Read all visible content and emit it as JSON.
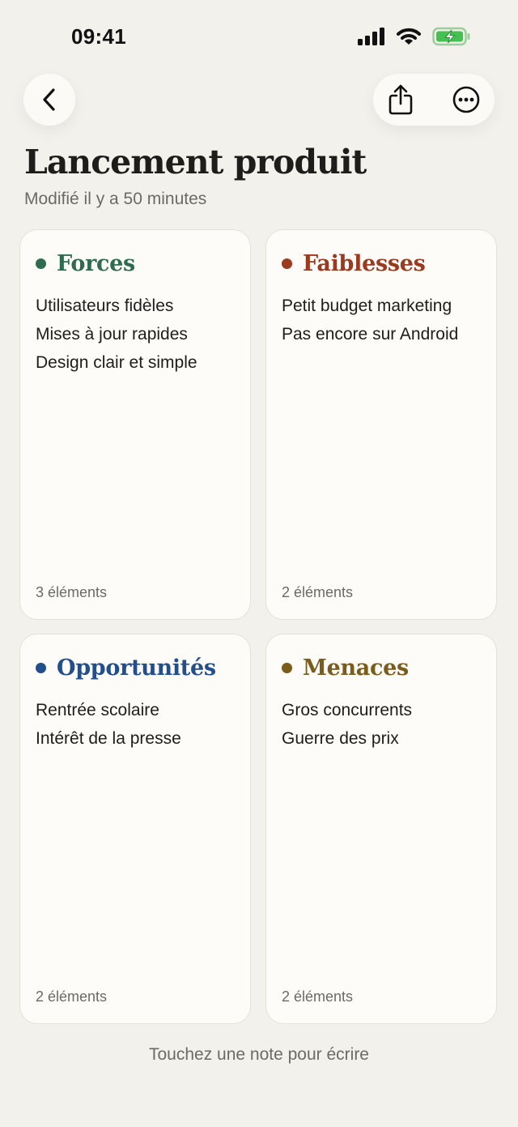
{
  "status": {
    "time": "09:41"
  },
  "icons": {
    "back": "chevron-left-icon",
    "share": "share-icon",
    "more": "ellipsis-circle-icon"
  },
  "note": {
    "title": "Lancement produit",
    "subtitle": "Modifié il y a 50 minutes"
  },
  "quadrants": [
    {
      "title": "Forces",
      "color": "#2F6B4F",
      "items": [
        "Utilisateurs fidèles",
        "Mises à jour rapides",
        "Design clair et simple"
      ],
      "count": "3 éléments"
    },
    {
      "title": "Faiblesses",
      "color": "#9A3A1F",
      "items": [
        "Petit budget marketing",
        "Pas encore sur Android"
      ],
      "count": "2 éléments"
    },
    {
      "title": "Opportunités",
      "color": "#234E8C",
      "items": [
        "Rentrée scolaire",
        "Intérêt de la presse"
      ],
      "count": "2 éléments"
    },
    {
      "title": "Menaces",
      "color": "#7A5C1B",
      "items": [
        "Gros concurrents",
        "Guerre des prix"
      ],
      "count": "2 éléments"
    }
  ],
  "hint": "Touchez une note pour écrire"
}
